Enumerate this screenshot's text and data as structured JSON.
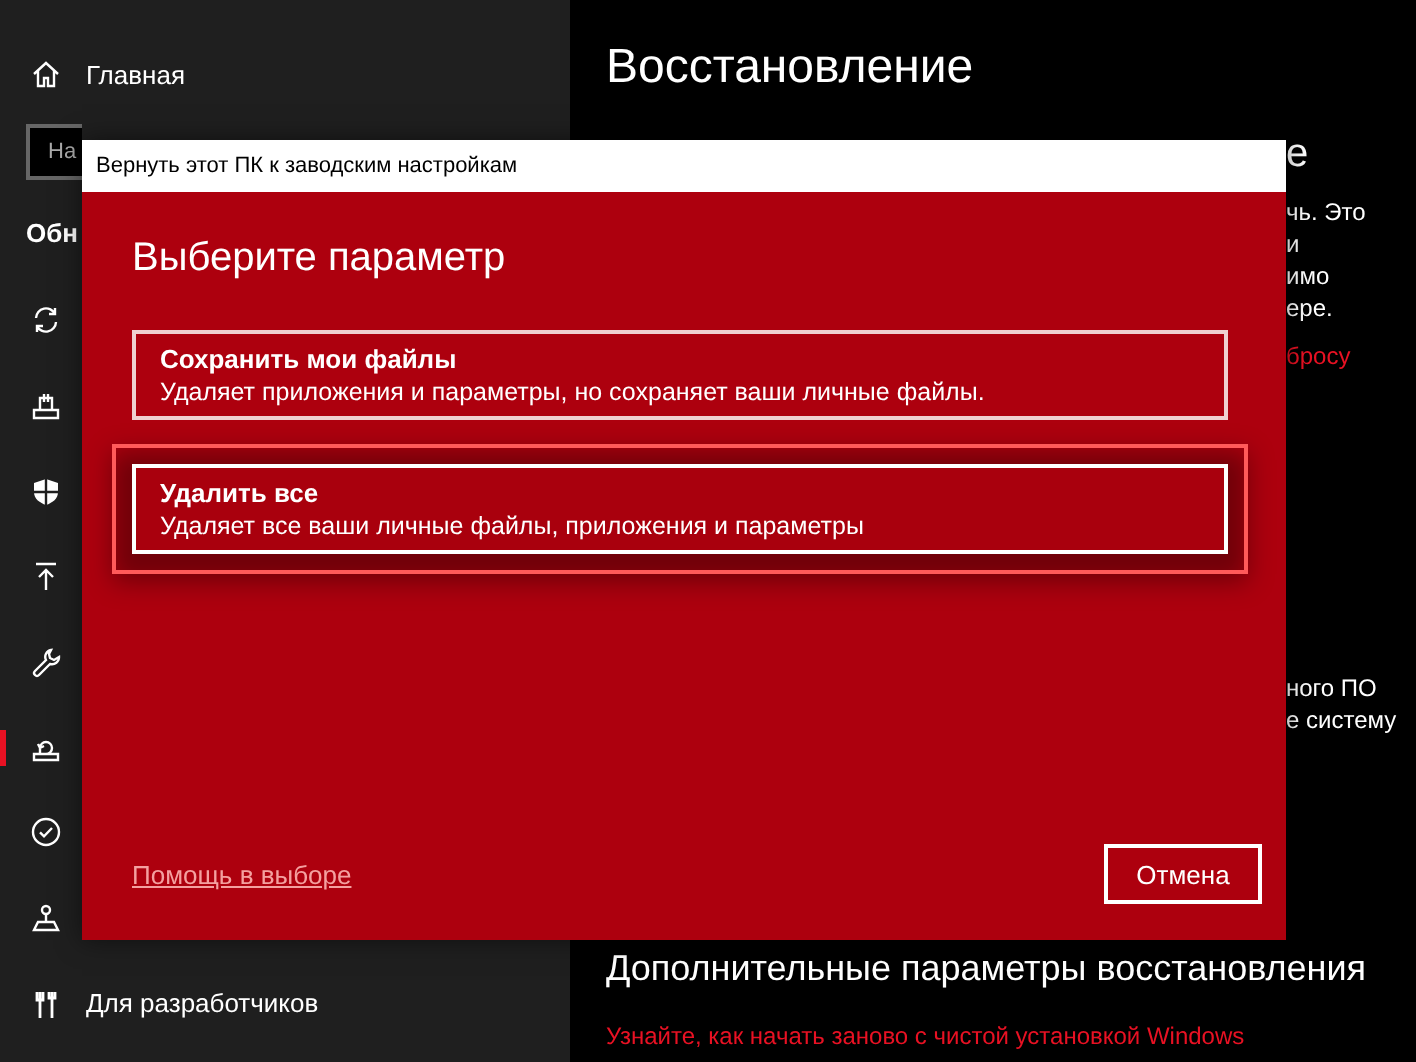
{
  "sidebar": {
    "home": {
      "label": "Главная"
    },
    "search": {
      "placeholder": "На"
    },
    "section": "Обн",
    "items": [
      {
        "kind": "sync",
        "selected": false
      },
      {
        "kind": "delivery",
        "selected": false
      },
      {
        "kind": "shield",
        "selected": false
      },
      {
        "kind": "upload",
        "selected": false
      },
      {
        "kind": "wrench",
        "selected": false
      },
      {
        "kind": "recovery",
        "selected": true
      },
      {
        "kind": "check",
        "selected": false
      },
      {
        "kind": "person",
        "selected": false
      },
      {
        "kind": "tools",
        "selected": false,
        "label": "Для разработчиков"
      }
    ]
  },
  "main": {
    "title": "Восстановление",
    "fragments": [
      {
        "text": "е",
        "kind": "heading"
      },
      {
        "text": "чь. Это",
        "kind": "text"
      },
      {
        "text": "и",
        "kind": "text"
      },
      {
        "text": "имо",
        "kind": "text"
      },
      {
        "text": "ере.",
        "kind": "text"
      },
      {
        "text": "бросу",
        "kind": "link"
      }
    ],
    "lower_fragments": [
      "ного ПО",
      "е систему"
    ],
    "section_title": "Дополнительные параметры восстановления",
    "link": "Узнайте, как начать заново с чистой установкой Windows"
  },
  "dialog": {
    "title": "Вернуть этот ПК к заводским настройкам",
    "heading": "Выберите параметр",
    "options": [
      {
        "title": "Сохранить мои файлы",
        "description": "Удаляет приложения и параметры, но сохраняет ваши личные файлы.",
        "selected": false
      },
      {
        "title": "Удалить все",
        "description": "Удаляет все ваши личные файлы, приложения и параметры",
        "selected": true
      }
    ],
    "help_link": "Помощь в выборе",
    "cancel": "Отмена"
  }
}
